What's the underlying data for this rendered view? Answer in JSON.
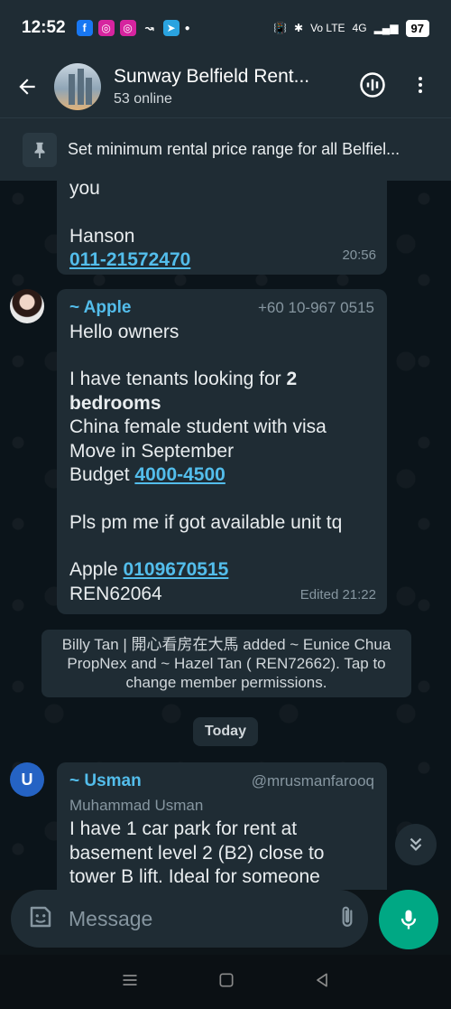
{
  "status_bar": {
    "time": "12:52",
    "network_label": "Vo LTE",
    "network_type": "4G",
    "battery": "97"
  },
  "header": {
    "group_name": "Sunway Belfield Rent...",
    "subtitle": "53 online"
  },
  "pinned": {
    "text": "Set minimum rental price range for all Belfiel..."
  },
  "messages": {
    "msg1": {
      "line_top": "you",
      "name": "Hanson",
      "phone": "011-21572470",
      "time": "20:56"
    },
    "msg2": {
      "sender": "~ Apple",
      "sender_phone": "+60 10-967 0515",
      "greeting": "Hello owners",
      "line1_pre": "I have tenants looking for ",
      "line1_bold": "2 bedrooms",
      "line2": "China female student with visa",
      "line3": "Move in September",
      "budget_label": "Budget ",
      "budget_value": "4000-4500",
      "line4": "Pls pm me if got available unit tq",
      "contact_label": "Apple ",
      "contact_phone": "0109670515",
      "reg": "REN62064",
      "time": "Edited 21:22"
    },
    "system": "Billy Tan | 開心看房在大馬 added ~ Eunice Chua PropNex and ~ Hazel Tan ( REN72662). Tap to change member permissions.",
    "date_chip": "Today",
    "msg3": {
      "avatar_letter": "U",
      "sender": "~ Usman",
      "handle": "@mrusmanfarooq",
      "full_name": "Muhammad Usman",
      "body": "I have 1 car park for rent at basement level 2 (B2) close to tower B lift. Ideal for someone"
    }
  },
  "composer": {
    "placeholder": "Message"
  },
  "colors": {
    "accent_green": "#00a884",
    "link_blue": "#53bdeb",
    "apple_name": "#53bdeb",
    "usman_name": "#53bdeb",
    "bubble_bg": "#1f2c34"
  },
  "icons": {
    "back": "arrow-left-icon",
    "voice_chat": "voice-chat-icon",
    "menu": "more-vertical-icon",
    "pin": "pin-icon",
    "scroll": "chevron-double-down-icon",
    "emoji": "sticker-icon",
    "attach": "paperclip-icon",
    "camera": "camera-icon",
    "mic": "microphone-icon"
  }
}
